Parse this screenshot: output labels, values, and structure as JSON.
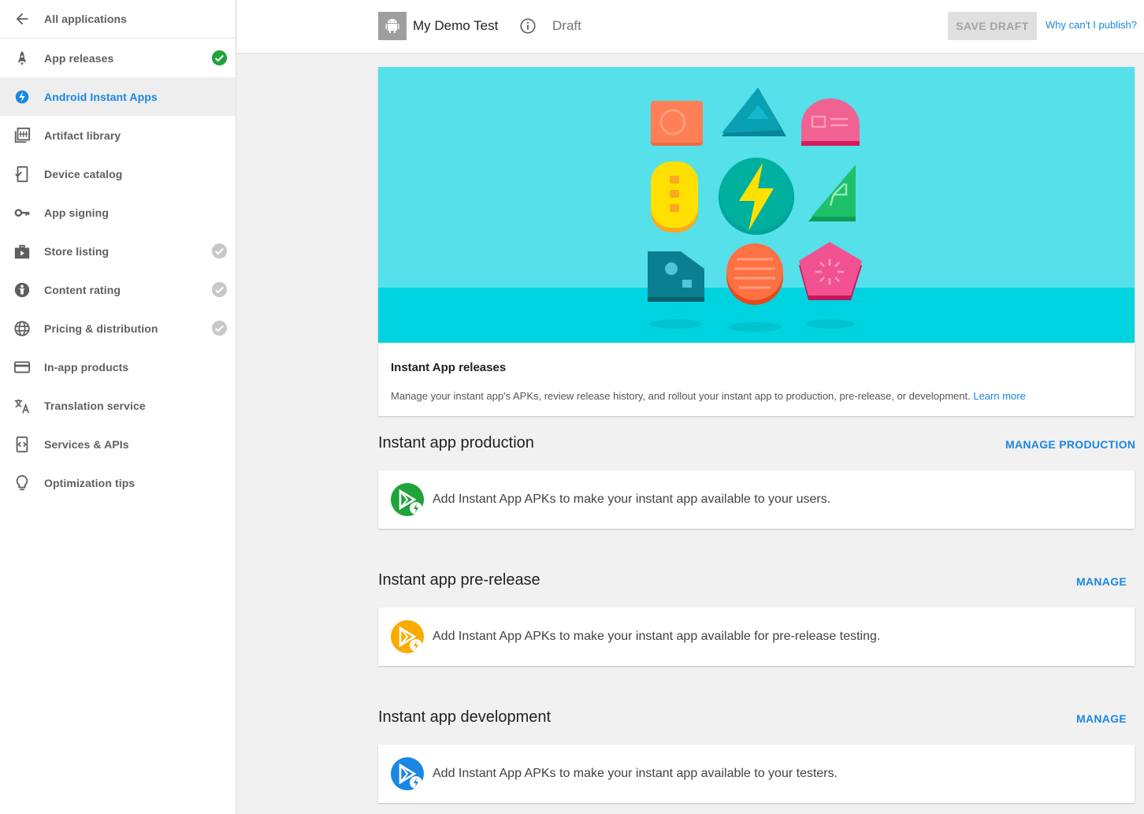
{
  "sidebar": {
    "back_label": "All applications",
    "items": [
      {
        "label": "App releases",
        "icon": "rocket-icon",
        "status": "complete"
      },
      {
        "label": "Android Instant Apps",
        "icon": "instant-bolt-icon",
        "status": "active"
      },
      {
        "label": "Artifact library",
        "icon": "library-icon",
        "status": ""
      },
      {
        "label": "Device catalog",
        "icon": "device-icon",
        "status": ""
      },
      {
        "label": "App signing",
        "icon": "key-icon",
        "status": ""
      },
      {
        "label": "Store listing",
        "icon": "store-icon",
        "status": "pending"
      },
      {
        "label": "Content rating",
        "icon": "rating-icon",
        "status": "pending"
      },
      {
        "label": "Pricing & distribution",
        "icon": "globe-icon",
        "status": "pending"
      },
      {
        "label": "In-app products",
        "icon": "card-icon",
        "status": ""
      },
      {
        "label": "Translation service",
        "icon": "translate-icon",
        "status": ""
      },
      {
        "label": "Services & APIs",
        "icon": "api-icon",
        "status": ""
      },
      {
        "label": "Optimization tips",
        "icon": "lightbulb-icon",
        "status": ""
      }
    ]
  },
  "header": {
    "app_name": "My Demo Test",
    "status": "Draft",
    "save_label": "SAVE DRAFT",
    "why_link": "Why can't I publish?"
  },
  "banner": {
    "title": "Instant App releases",
    "description": "Manage your instant app's APKs, review release history, and rollout your instant app to production, pre-release, or development.",
    "learn_more": "Learn more"
  },
  "tracks": [
    {
      "title": "Instant app production",
      "action": "MANAGE PRODUCTION",
      "message": "Add Instant App APKs to make your instant app available to your users.",
      "color": "#1fa33a"
    },
    {
      "title": "Instant app pre-release",
      "action": "MANAGE",
      "message": "Add Instant App APKs to make your instant app available for pre-release testing.",
      "color": "#f9ab00"
    },
    {
      "title": "Instant app development",
      "action": "MANAGE",
      "message": "Add Instant App APKs to make your instant app available to your testers.",
      "color": "#1a87e4"
    }
  ],
  "colors": {
    "accent": "#1a87e4",
    "complete": "#1fa33a",
    "pending": "#c8c8c8"
  }
}
